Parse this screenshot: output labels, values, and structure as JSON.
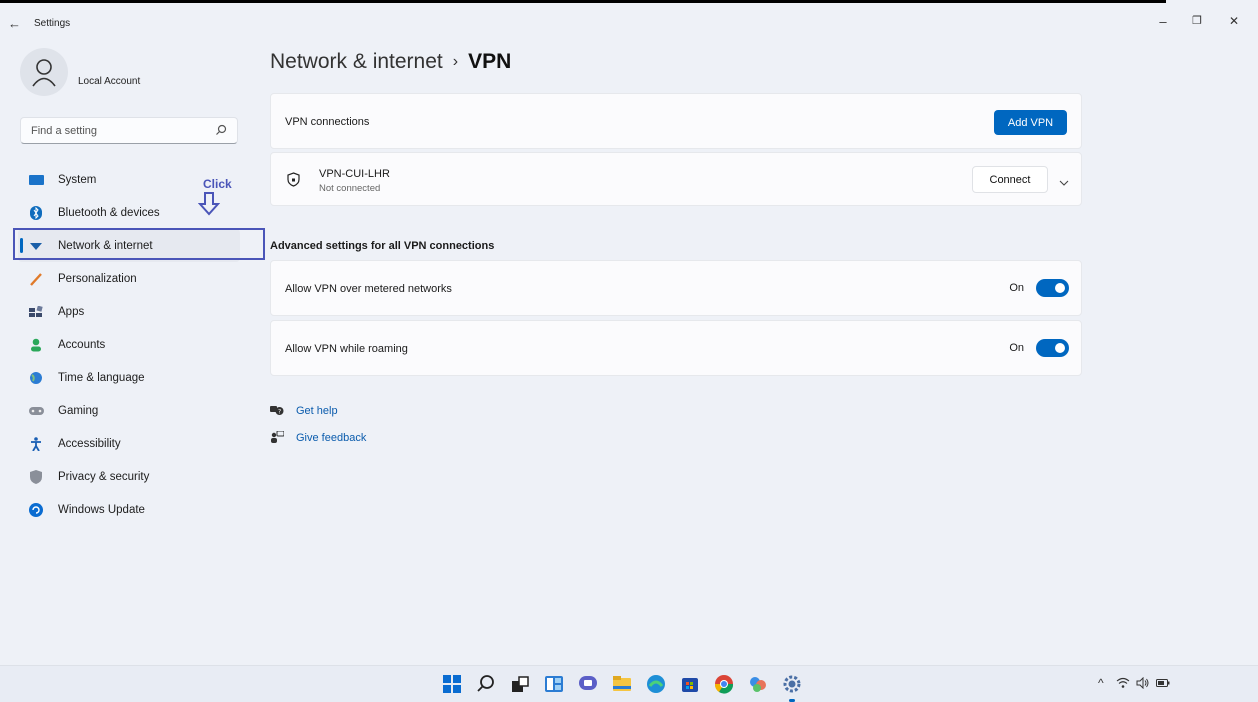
{
  "window": {
    "title": "Settings",
    "back_glyph": "←",
    "minimize_glyph": "–",
    "restore_glyph": "❐",
    "close_glyph": "✕"
  },
  "account": {
    "name": "Local Account",
    "icon": "person-icon"
  },
  "search": {
    "placeholder": "Find a setting",
    "icon": "search-icon"
  },
  "sidebar": {
    "items": [
      {
        "label": "System",
        "icon": "monitor-icon",
        "color": "#1a73c9"
      },
      {
        "label": "Bluetooth & devices",
        "icon": "bluetooth-icon",
        "color": "#0f6cbd"
      },
      {
        "label": "Network & internet",
        "icon": "wifi-diamond-icon",
        "color": "#1b5fa8",
        "active": true
      },
      {
        "label": "Personalization",
        "icon": "brush-icon",
        "color": "#e07a2a"
      },
      {
        "label": "Apps",
        "icon": "apps-icon",
        "color": "#3b4a6b"
      },
      {
        "label": "Accounts",
        "icon": "person-icon",
        "color": "#2aa85a"
      },
      {
        "label": "Time & language",
        "icon": "globe-clock-icon",
        "color": "#2b7cd3"
      },
      {
        "label": "Gaming",
        "icon": "gamepad-icon",
        "color": "#8a8f99"
      },
      {
        "label": "Accessibility",
        "icon": "accessibility-icon",
        "color": "#1a5fb4"
      },
      {
        "label": "Privacy & security",
        "icon": "shield-icon",
        "color": "#8a8f99"
      },
      {
        "label": "Windows Update",
        "icon": "update-icon",
        "color": "#0a6cd1"
      }
    ]
  },
  "annotation": {
    "click_label": "Click"
  },
  "main": {
    "breadcrumb_parent": "Network & internet",
    "breadcrumb_sep": "›",
    "breadcrumb_current": "VPN",
    "vpn_connections_label": "VPN connections",
    "add_vpn_label": "Add VPN",
    "vpn": {
      "name": "VPN-CUI-LHR",
      "status": "Not connected",
      "connect_label": "Connect"
    },
    "advanced_title": "Advanced settings for all VPN connections",
    "settings": [
      {
        "label": "Allow VPN over metered networks",
        "state": "On",
        "on": true
      },
      {
        "label": "Allow VPN while roaming",
        "state": "On",
        "on": true
      }
    ],
    "links": [
      {
        "label": "Get help",
        "icon": "help-icon"
      },
      {
        "label": "Give feedback",
        "icon": "feedback-icon"
      }
    ]
  },
  "taskbar": {
    "apps": [
      "windows-start-icon",
      "search-icon",
      "task-view-icon",
      "widgets-icon",
      "chat-icon",
      "file-explorer-icon",
      "edge-icon",
      "store-icon",
      "chrome-icon",
      "photos-icon",
      "settings-gear-icon"
    ],
    "tray": {
      "chevron": "^",
      "wifi": "wifi-icon",
      "volume": "volume-icon",
      "battery": "battery-icon"
    }
  },
  "colors": {
    "accent": "#0067c0",
    "annotation": "#4a55b8",
    "background": "#eef1f7"
  }
}
